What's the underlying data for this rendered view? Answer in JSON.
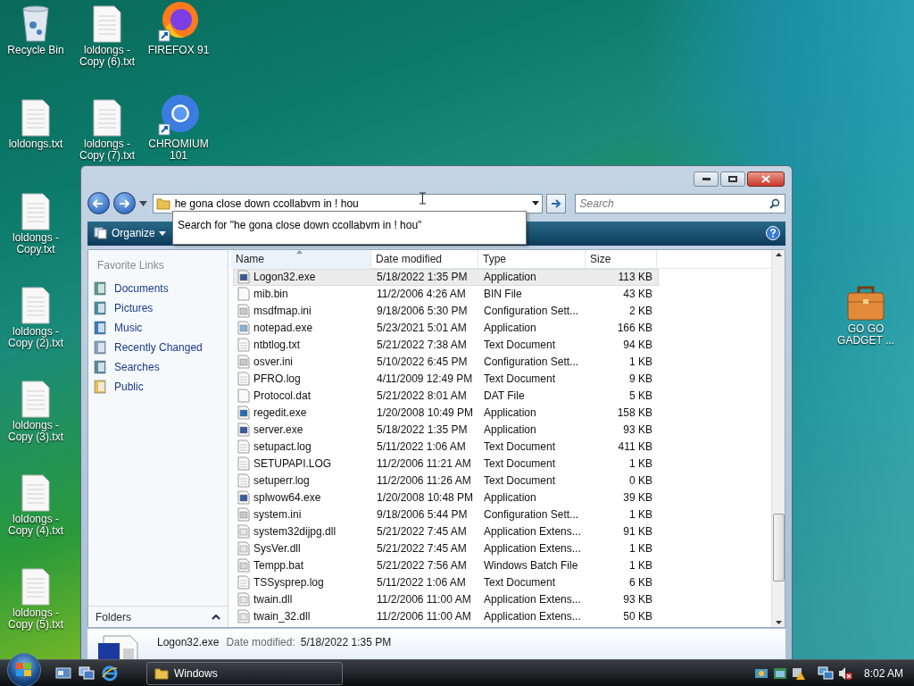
{
  "desktop_columns": [
    [
      {
        "label": "Recycle Bin",
        "kind": "recycle"
      },
      {
        "label": "loldongs.txt",
        "kind": "text"
      },
      {
        "label": "loldongs - Copy.txt",
        "kind": "text"
      },
      {
        "label": "loldongs - Copy (2).txt",
        "kind": "text"
      },
      {
        "label": "loldongs - Copy (3).txt",
        "kind": "text"
      },
      {
        "label": "loldongs - Copy (4).txt",
        "kind": "text"
      },
      {
        "label": "loldongs - Copy (5).txt",
        "kind": "text"
      }
    ],
    [
      {
        "label": "loldongs - Copy (6).txt",
        "kind": "text"
      },
      {
        "label": "loldongs - Copy (7).txt",
        "kind": "text"
      }
    ],
    [
      {
        "label": "FIREFOX 91",
        "kind": "firefox"
      },
      {
        "label": "CHROMIUM 101",
        "kind": "chromium"
      }
    ]
  ],
  "gadget_icon": {
    "label": "GO GO GADGET ...",
    "kind": "briefcase"
  },
  "window": {
    "address": "he gona close down ccollabvm in ! hou",
    "search_placeholder": "Search",
    "suggestion": "Search for \"he gona close down ccollabvm in ! hou\"",
    "organize": "Organize",
    "nav": {
      "heading": "Favorite Links",
      "items": [
        {
          "label": "Documents",
          "kind": "documents"
        },
        {
          "label": "Pictures",
          "kind": "pictures"
        },
        {
          "label": "Music",
          "kind": "music"
        },
        {
          "label": "Recently Changed",
          "kind": "recent"
        },
        {
          "label": "Searches",
          "kind": "searches"
        },
        {
          "label": "Public",
          "kind": "public"
        }
      ],
      "folders": "Folders"
    },
    "columns": [
      "Name",
      "Date modified",
      "Type",
      "Size"
    ],
    "rows": [
      {
        "name": "Logon32.exe",
        "date": "5/18/2022 1:35 PM",
        "type": "Application",
        "size": "113 KB",
        "kind": "app",
        "selected": true
      },
      {
        "name": "mib.bin",
        "date": "11/2/2006 4:26 AM",
        "type": "BIN File",
        "size": "43 KB",
        "kind": "blank",
        "selected": false
      },
      {
        "name": "msdfmap.ini",
        "date": "9/18/2006 5:30 PM",
        "type": "Configuration Sett...",
        "size": "2 KB",
        "kind": "config",
        "selected": false
      },
      {
        "name": "notepad.exe",
        "date": "5/23/2021 5:01 AM",
        "type": "Application",
        "size": "166 KB",
        "kind": "notepad",
        "selected": false
      },
      {
        "name": "ntbtlog.txt",
        "date": "5/21/2022 7:38 AM",
        "type": "Text Document",
        "size": "94 KB",
        "kind": "text",
        "selected": false
      },
      {
        "name": "osver.ini",
        "date": "5/10/2022 6:45 PM",
        "type": "Configuration Sett...",
        "size": "1 KB",
        "kind": "config",
        "selected": false
      },
      {
        "name": "PFRO.log",
        "date": "4/11/2009 12:49 PM",
        "type": "Text Document",
        "size": "9 KB",
        "kind": "text",
        "selected": false
      },
      {
        "name": "Protocol.dat",
        "date": "5/21/2022 8:01 AM",
        "type": "DAT File",
        "size": "5 KB",
        "kind": "blank",
        "selected": false
      },
      {
        "name": "regedit.exe",
        "date": "1/20/2008 10:49 PM",
        "type": "Application",
        "size": "158 KB",
        "kind": "regedit",
        "selected": false
      },
      {
        "name": "server.exe",
        "date": "5/18/2022 1:35 PM",
        "type": "Application",
        "size": "93 KB",
        "kind": "app",
        "selected": false
      },
      {
        "name": "setupact.log",
        "date": "5/11/2022 1:06 AM",
        "type": "Text Document",
        "size": "411 KB",
        "kind": "text",
        "selected": false
      },
      {
        "name": "SETUPAPI.LOG",
        "date": "11/2/2006 11:21 AM",
        "type": "Text Document",
        "size": "1 KB",
        "kind": "text",
        "selected": false
      },
      {
        "name": "setuperr.log",
        "date": "11/2/2006 11:26 AM",
        "type": "Text Document",
        "size": "0 KB",
        "kind": "text",
        "selected": false
      },
      {
        "name": "splwow64.exe",
        "date": "1/20/2008 10:48 PM",
        "type": "Application",
        "size": "39 KB",
        "kind": "app",
        "selected": false
      },
      {
        "name": "system.ini",
        "date": "9/18/2006 5:44 PM",
        "type": "Configuration Sett...",
        "size": "1 KB",
        "kind": "config",
        "selected": false
      },
      {
        "name": "system32dijpg.dll",
        "date": "5/21/2022 7:45 AM",
        "type": "Application Extens...",
        "size": "91 KB",
        "kind": "dll",
        "selected": false
      },
      {
        "name": "SysVer.dll",
        "date": "5/21/2022 7:45 AM",
        "type": "Application Extens...",
        "size": "1 KB",
        "kind": "dll",
        "selected": false
      },
      {
        "name": "Tempp.bat",
        "date": "5/21/2022 7:56 AM",
        "type": "Windows Batch File",
        "size": "1 KB",
        "kind": "batch",
        "selected": false
      },
      {
        "name": "TSSysprep.log",
        "date": "5/11/2022 1:06 AM",
        "type": "Text Document",
        "size": "6 KB",
        "kind": "text",
        "selected": false
      },
      {
        "name": "twain.dll",
        "date": "11/2/2006 11:00 AM",
        "type": "Application Extens...",
        "size": "93 KB",
        "kind": "dll",
        "selected": false
      },
      {
        "name": "twain_32.dll",
        "date": "11/2/2006 11:00 AM",
        "type": "Application Extens...",
        "size": "50 KB",
        "kind": "dll",
        "selected": false
      }
    ],
    "details": {
      "name": "Logon32.exe",
      "date_label": "Date modified:",
      "date": "5/18/2022 1:35 PM"
    }
  },
  "taskbar": {
    "task": "Windows",
    "clock": "8:02 AM"
  }
}
